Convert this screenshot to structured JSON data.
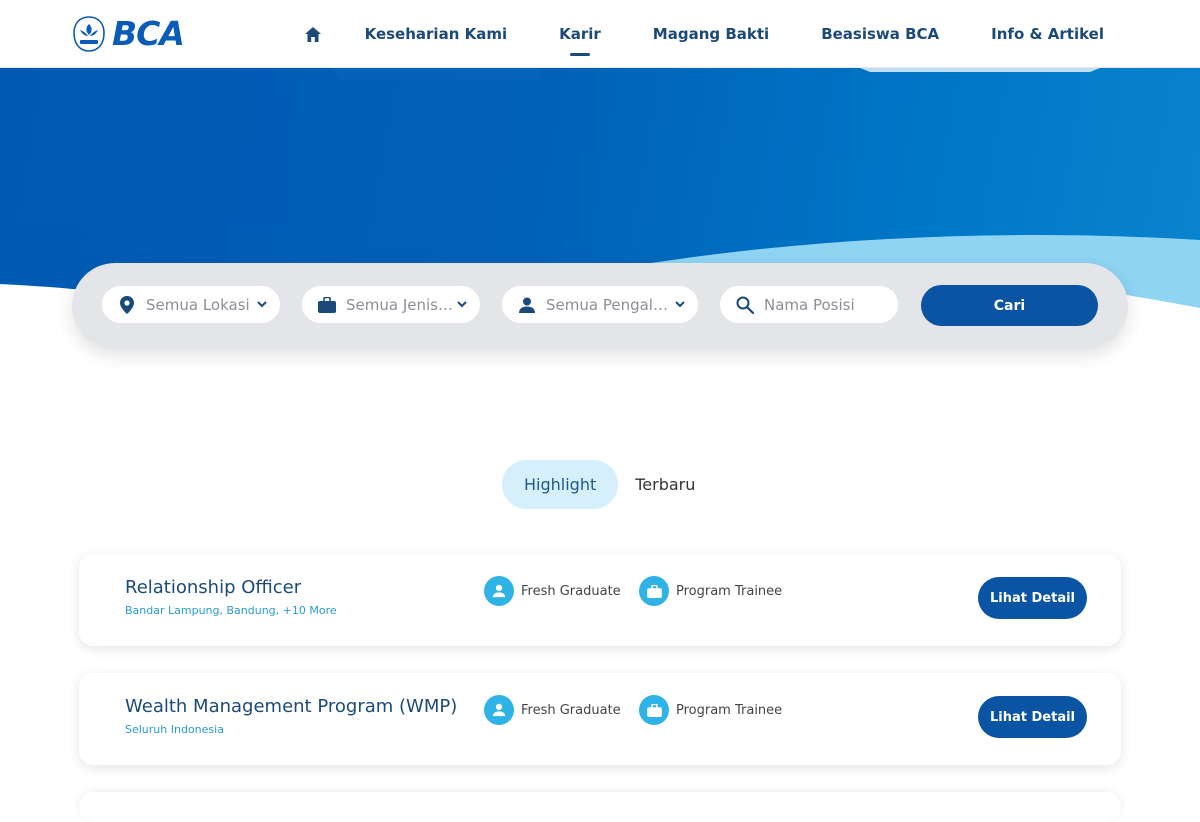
{
  "brand": {
    "name": "BCA"
  },
  "nav": {
    "home_icon": "home-icon",
    "items": [
      {
        "label": "Keseharian Kami",
        "active": false
      },
      {
        "label": "Karir",
        "active": true
      },
      {
        "label": "Magang Bakti",
        "active": false
      },
      {
        "label": "Beasiswa BCA",
        "active": false
      },
      {
        "label": "Info & Artikel",
        "active": false
      }
    ]
  },
  "search": {
    "location": {
      "label": "Semua Lokasi",
      "icon": "map-pin-icon"
    },
    "job_type": {
      "label": "Semua Jenis Lowongan",
      "icon": "briefcase-icon"
    },
    "experience": {
      "label": "Semua Pengalaman",
      "icon": "person-icon"
    },
    "position": {
      "placeholder": "Nama Posisi",
      "value": "",
      "icon": "search-icon"
    },
    "button_label": "Cari"
  },
  "tabs": [
    {
      "label": "Highlight",
      "active": true
    },
    {
      "label": "Terbaru",
      "active": false
    }
  ],
  "jobs": [
    {
      "title": "Relationship Officer",
      "locations": "Bandar Lampung, Bandung,  +10 More",
      "experience": "Fresh Graduate",
      "type": "Program Trainee",
      "button_label": "Lihat Detail"
    },
    {
      "title": "Wealth Management Program (WMP)",
      "locations": "Seluruh Indonesia",
      "experience": "Fresh Graduate",
      "type": "Program Trainee",
      "button_label": "Lihat Detail"
    }
  ],
  "colors": {
    "primary": "#0a54a3",
    "nav_text": "#1b4a78",
    "accent_light": "#d6f0fb",
    "tag_icon_bg": "#2fb3e6",
    "hero_blue": "#0061b8",
    "wave_light": "#8fd4f3"
  }
}
